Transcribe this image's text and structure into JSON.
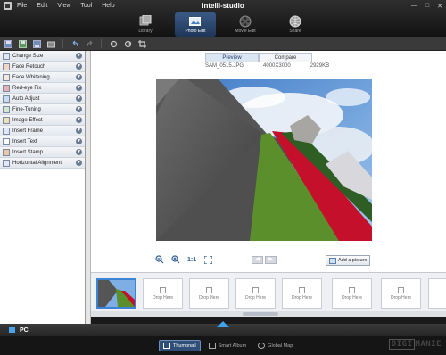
{
  "window": {
    "title": "intelli-studio",
    "menu": [
      "File",
      "Edit",
      "View",
      "Tool",
      "Help"
    ]
  },
  "mode_tabs": [
    {
      "label": "Library",
      "icon": "library-icon",
      "active": false
    },
    {
      "label": "Photo Edit",
      "icon": "photo-edit-icon",
      "active": true
    },
    {
      "label": "Movie Edit",
      "icon": "film-reel-icon",
      "active": false
    },
    {
      "label": "Share",
      "icon": "globe-share-icon",
      "active": false
    }
  ],
  "toolbar_icons": [
    "save-icon",
    "save-as-icon",
    "save-all-icon",
    "export-icon",
    "undo-icon",
    "redo-icon",
    "rotate-left-icon",
    "rotate-right-icon",
    "crop-icon"
  ],
  "edit_panel": {
    "items": [
      {
        "label": "Change Size",
        "icon": "resize-icon"
      },
      {
        "label": "Face Retouch",
        "icon": "face-retouch-icon"
      },
      {
        "label": "Face Whitening",
        "icon": "face-whitening-icon"
      },
      {
        "label": "Red-eye Fix",
        "icon": "red-eye-icon"
      },
      {
        "label": "Auto Adjust",
        "icon": "auto-adjust-icon"
      },
      {
        "label": "Fine-Tuning",
        "icon": "fine-tuning-icon"
      },
      {
        "label": "Image Effect",
        "icon": "image-effect-icon"
      },
      {
        "label": "Insert Frame",
        "icon": "frame-icon"
      },
      {
        "label": "Insert Text",
        "icon": "text-icon"
      },
      {
        "label": "Insert Stamp",
        "icon": "stamp-icon"
      },
      {
        "label": "Horizontal Alignment",
        "icon": "align-icon"
      }
    ]
  },
  "view": {
    "tabs": [
      "Preview",
      "Compare"
    ],
    "active_tab": "Preview",
    "file_name": "SAM_0515.JPG",
    "dimensions": "4000X3000",
    "file_size": "2929KB"
  },
  "zoom": {
    "one_to_one": "1:1"
  },
  "add_picture_label": "Add a picture",
  "filmstrip": {
    "drop_label": "Drop Here",
    "drop_slots": 6
  },
  "pc_bar": {
    "label": "PC"
  },
  "bottom_tabs": [
    {
      "label": "Thumbnail",
      "active": true
    },
    {
      "label": "Smart Album",
      "active": false
    },
    {
      "label": "Global Map",
      "active": false
    }
  ],
  "watermark": {
    "part1": "DIGI",
    "part2": "MANIE"
  }
}
